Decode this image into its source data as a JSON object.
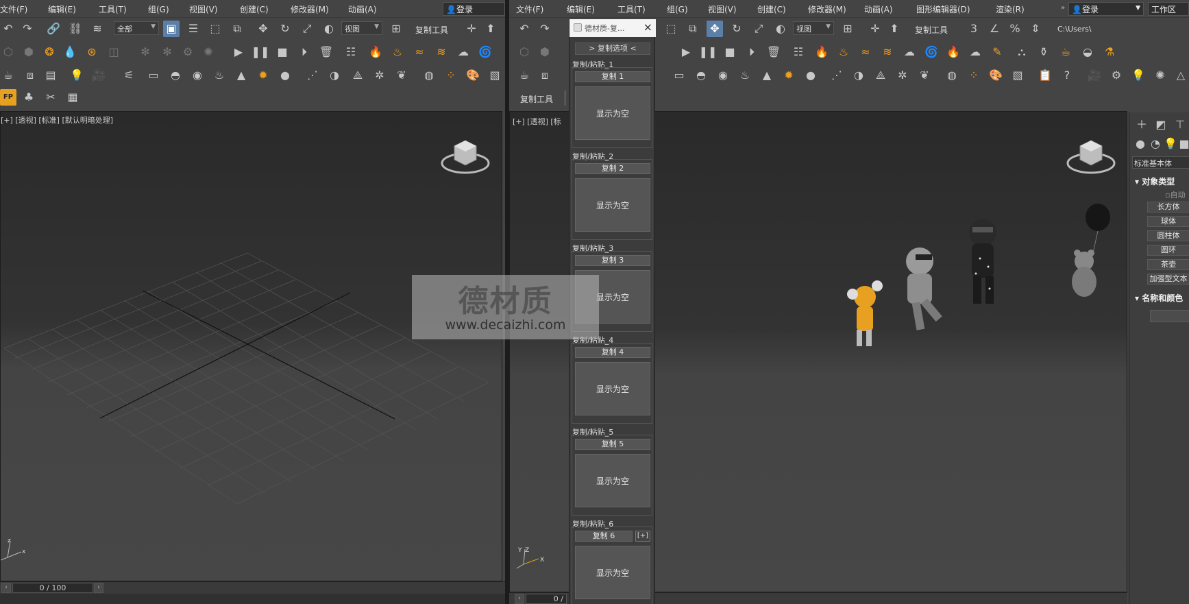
{
  "left_window": {
    "menu": [
      "文件(F)",
      "编辑(E)",
      "工具(T)",
      "组(G)",
      "视图(V)",
      "创建(C)",
      "修改器(M)",
      "动画(A)"
    ],
    "login": "登录",
    "selection_filter": "全部",
    "ref_coord": "视图",
    "copy_tool_label": "复制工具",
    "viewport_label": "[+] [透视] [标准] [默认明暗处理]",
    "time_value": "0 / 100"
  },
  "right_window": {
    "menu": [
      "文件(F)",
      "编辑(E)",
      "工具(T)",
      "组(G)",
      "视图(V)",
      "创建(C)",
      "修改器(M)",
      "动画(A)",
      "图形编辑器(D)",
      "渲染(R)"
    ],
    "login": "登录",
    "workspace": "工作区",
    "ref_coord": "视图",
    "copy_tool_label": "复制工具",
    "copy_tool_tab": "复制工具",
    "path": "C:\\Users\\",
    "viewport_label": "[+] [透视] [标",
    "time_value": "0 /"
  },
  "copy_panel": {
    "title": "德材质-复...",
    "options_label": "> 复制选项 <",
    "slots": [
      {
        "title": "复制/粘贴_1",
        "copy": "复制 1",
        "show": "显示为空"
      },
      {
        "title": "复制/粘贴_2",
        "copy": "复制 2",
        "show": "显示为空"
      },
      {
        "title": "复制/粘贴_3",
        "copy": "复制 3",
        "show": "显示为空"
      },
      {
        "title": "复制/粘贴_4",
        "copy": "复制 4",
        "show": "显示为空"
      },
      {
        "title": "复制/粘贴_5",
        "copy": "复制 5",
        "show": "显示为空"
      },
      {
        "title": "复制/粘贴_6",
        "copy": "复制 6",
        "show": "显示为空",
        "plus": "[+]"
      }
    ]
  },
  "command_panel": {
    "category": "标准基本体",
    "object_type_title": "对象类型",
    "auto_grid": "自动",
    "objects": [
      "长方体",
      "球体",
      "圆柱体",
      "圆环",
      "茶壶",
      "加强型文本"
    ],
    "name_color_title": "名称和颜色"
  },
  "watermark": {
    "brand": "德材质",
    "url": "www.decaizhi.com"
  },
  "colors": {
    "accent_orange": "#f0a020",
    "ui_bg": "#444444",
    "active_blue": "#5c7fa8"
  }
}
